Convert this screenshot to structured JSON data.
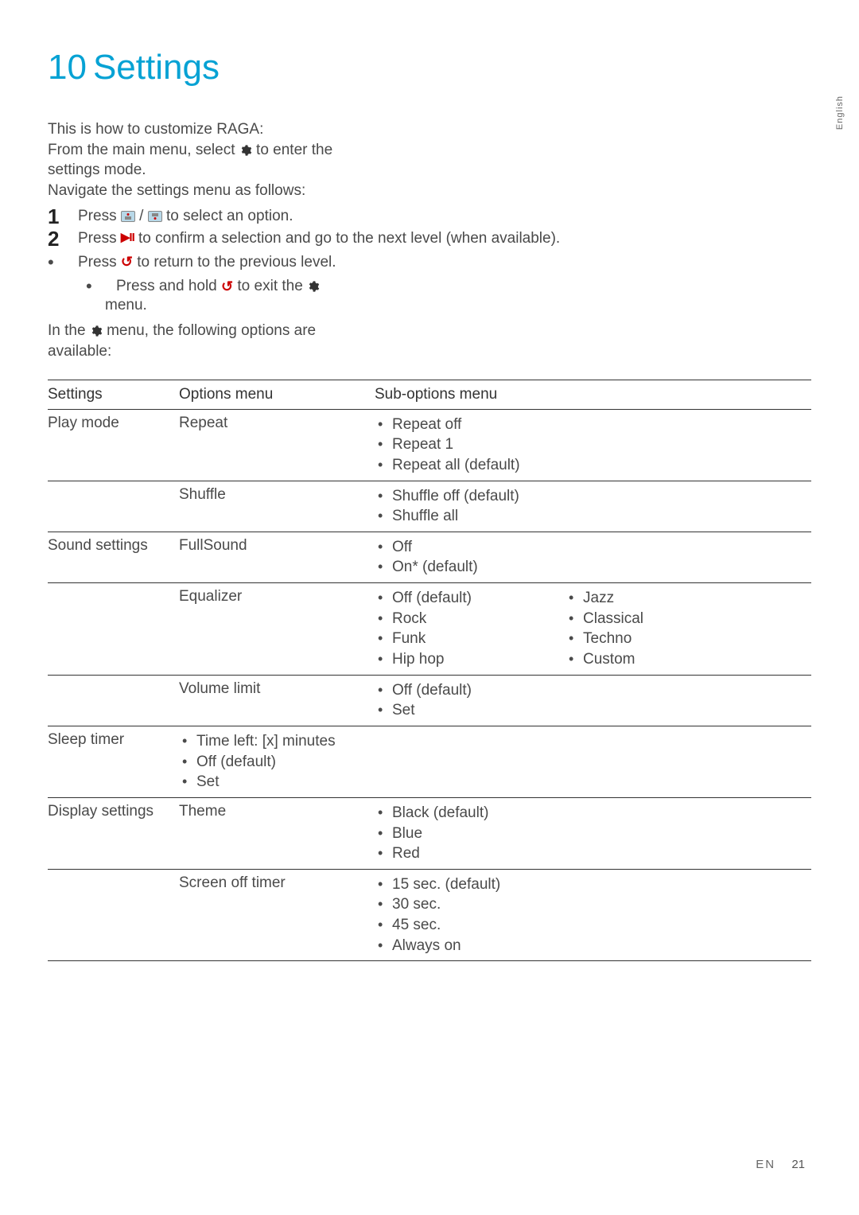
{
  "side_label": "English",
  "chapter": {
    "number": "10",
    "title": "Settings"
  },
  "intro": {
    "line1": "This is how to customize RAGA:",
    "line2_pre": "From the main menu, select ",
    "line2_post": " to enter the settings mode.",
    "line3": "Navigate the settings menu as follows:"
  },
  "nav": {
    "step1_pre": "Press ",
    "step1_mid": " / ",
    "step1_post": " to select an option.",
    "step2_pre": "Press ",
    "step2_post": " to confirm a selection and go to the next level (when available).",
    "bullet1_pre": "Press ",
    "bullet1_post": " to return to the previous level.",
    "sub_pre": "Press and hold ",
    "sub_mid": " to exit the ",
    "sub_menu": "menu."
  },
  "after_nav_pre": "In the ",
  "after_nav_post": " menu, the following options are available:",
  "table": {
    "headers": {
      "settings": "Settings",
      "options": "Options menu",
      "subopts": "Sub-options menu"
    },
    "groups": [
      {
        "setting": "Play mode",
        "rows": [
          {
            "option": "Repeat",
            "subopts": [
              "Repeat off",
              "Repeat 1",
              "Repeat all (default)"
            ]
          },
          {
            "option": "Shuffle",
            "subopts": [
              "Shuffle off (default)",
              "Shuffle all"
            ]
          }
        ]
      },
      {
        "setting": "Sound settings",
        "rows": [
          {
            "option": "FullSound",
            "subopts": [
              "Off",
              "On* (default)"
            ]
          },
          {
            "option": "Equalizer",
            "subopts_col1": [
              "Off (default)",
              "Rock",
              "Funk",
              "Hip hop"
            ],
            "subopts_col2": [
              "Jazz",
              "Classical",
              "Techno",
              "Custom"
            ]
          },
          {
            "option": "Volume limit",
            "subopts": [
              "Off (default)",
              "Set"
            ]
          }
        ]
      },
      {
        "setting": "Sleep timer",
        "rows": [
          {
            "options_list": [
              "Time left: [x] minutes",
              "Off (default)",
              "Set"
            ]
          }
        ]
      },
      {
        "setting": "Display settings",
        "rows": [
          {
            "option": "Theme",
            "subopts": [
              "Black (default)",
              "Blue",
              "Red"
            ]
          },
          {
            "option": "Screen off timer",
            "subopts": [
              "15 sec. (default)",
              "30 sec.",
              "45 sec.",
              "Always on"
            ]
          }
        ]
      }
    ]
  },
  "footer": {
    "lang": "EN",
    "page": "21"
  }
}
